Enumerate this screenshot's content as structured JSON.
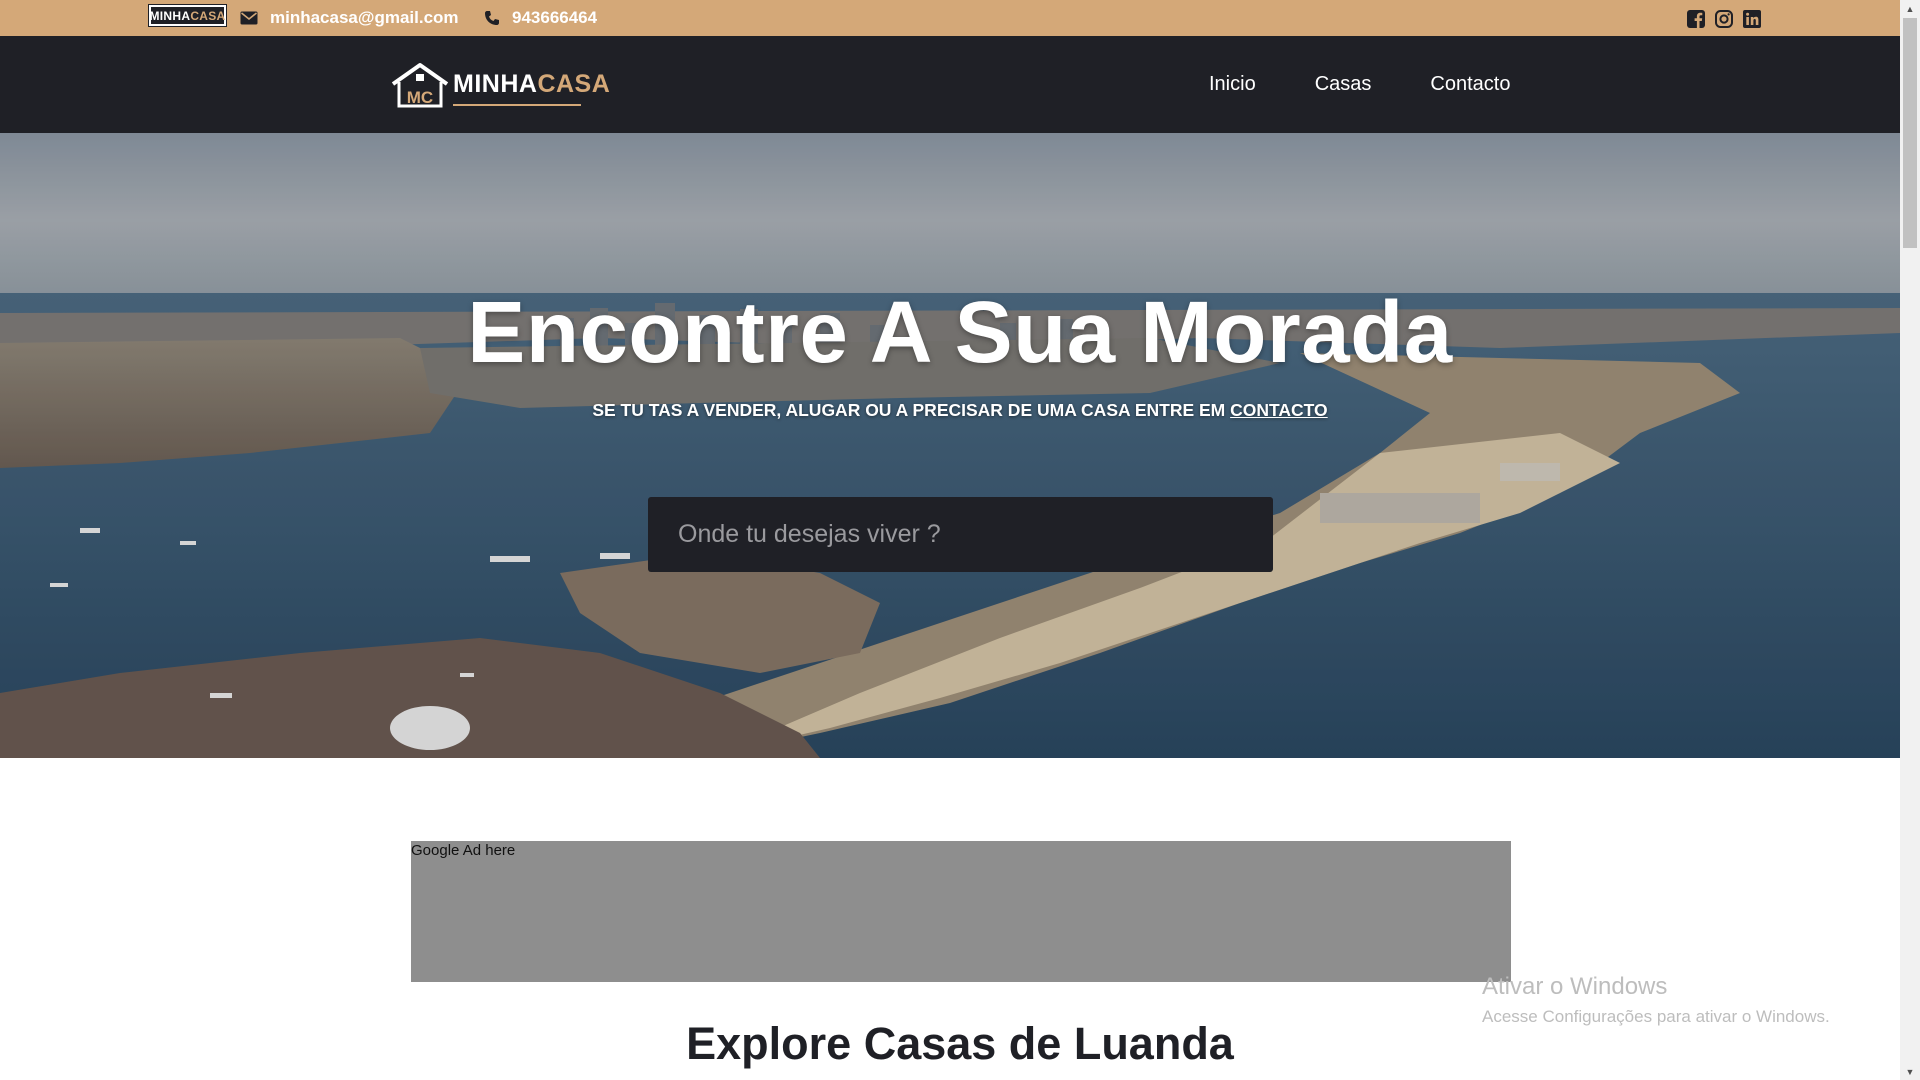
{
  "topbar": {
    "logo": {
      "white": "MINHA",
      "accent": "CASA"
    },
    "email": "minhacasa@gmail.com",
    "phone": "943666464",
    "social_icons": [
      "facebook-icon",
      "instagram-icon",
      "linkedin-icon"
    ]
  },
  "navbar": {
    "brand": {
      "badge": "MC",
      "white": "MINHA",
      "accent": "CASA"
    },
    "links": [
      "Inicio",
      "Casas",
      "Contacto"
    ]
  },
  "hero": {
    "title": "Encontre A Sua Morada",
    "subtitle_prefix": "SE TU TAS A VENDER, ALUGAR OU A PRECISAR DE UMA CASA ENTRE EM ",
    "subtitle_link": "CONTACTO",
    "search_placeholder": "Onde tu desejas viver ?"
  },
  "ad": {
    "label": "Google Ad here"
  },
  "section": {
    "title": "Explore Casas de Luanda"
  },
  "watermark": {
    "title": "Ativar o Windows",
    "subtitle": "Acesse Configurações para ativar o Windows."
  },
  "colors": {
    "accent": "#d4a878",
    "dark": "#1f2026",
    "ad_gray": "#8e8e8e"
  }
}
